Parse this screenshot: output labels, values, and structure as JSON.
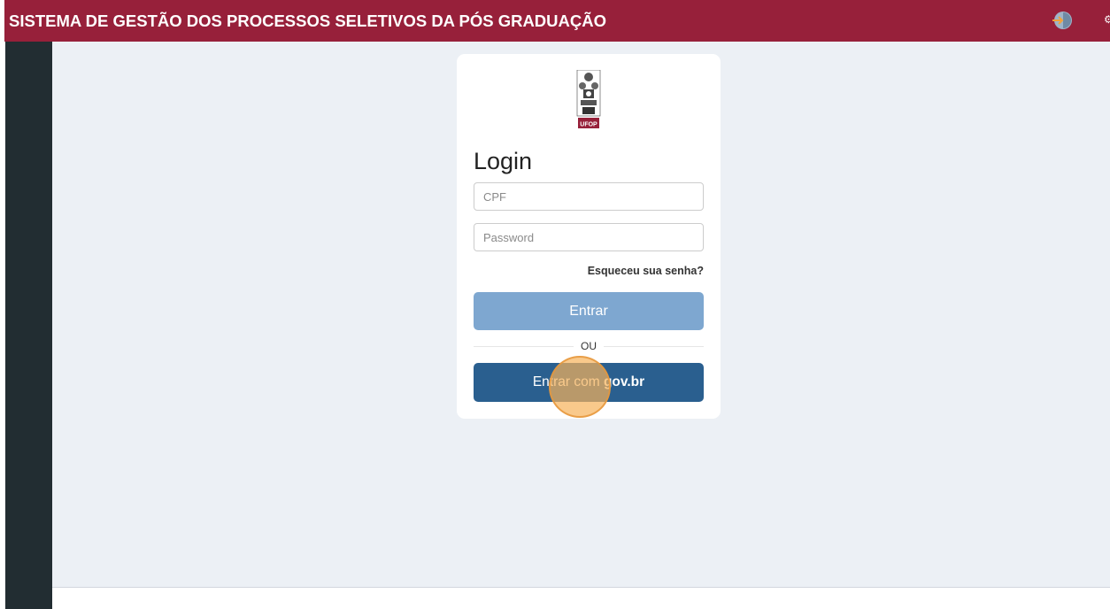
{
  "header": {
    "app_title": "SISTEMA DE GESTÃO DOS PROCESSOS SELETIVOS DA PÓS GRADUAÇÃO",
    "login_icon": "sign-in-icon",
    "settings_icon": "gear-icon",
    "background_color": "#97203a"
  },
  "sidebar": {
    "background_color": "#222d32"
  },
  "login_card": {
    "logo_text": "UFOP",
    "title": "Login",
    "cpf_placeholder": "CPF",
    "password_placeholder": "Password",
    "forgot_password_label": "Esqueceu sua senha?",
    "submit_label": "Entrar",
    "separator_label": "OU",
    "govbr_button": {
      "prefix": "Entrar com ",
      "brand": "gov.br"
    },
    "submit_color": "#7ea7d0",
    "govbr_color": "#2a5f8f"
  }
}
